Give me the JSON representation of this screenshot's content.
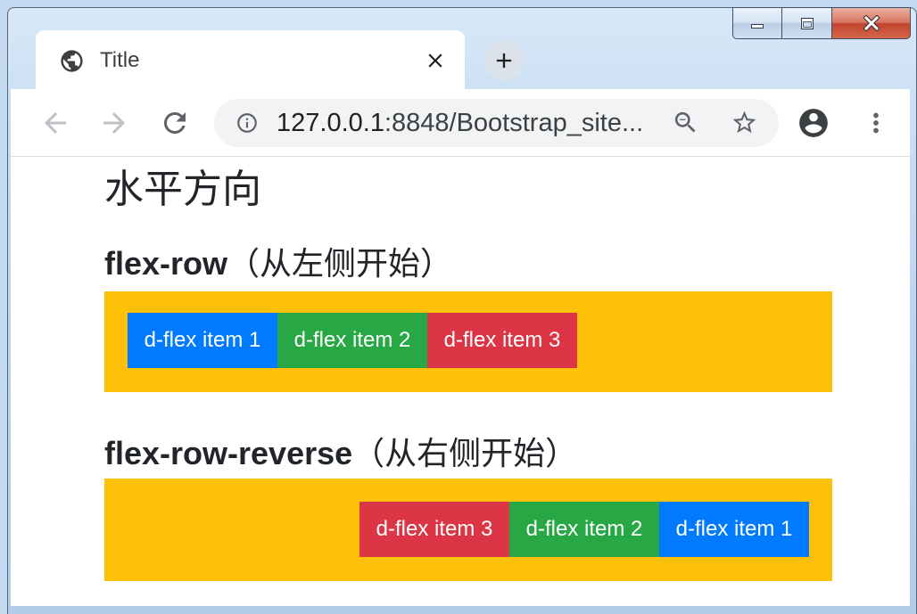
{
  "window_controls": {
    "minimize_icon": "minimize-icon",
    "maximize_icon": "maximize-icon",
    "close_icon": "close-icon"
  },
  "tab": {
    "favicon": "globe-icon",
    "title": "Title",
    "close_icon": "close-tab-icon"
  },
  "new_tab_icon": "plus-icon",
  "toolbar": {
    "back_icon": "arrow-back-icon",
    "forward_icon": "arrow-forward-icon",
    "reload_icon": "reload-icon",
    "site_info_icon": "info-icon",
    "url_host": "127.0.0.1",
    "url_rest": ":8848/Bootstrap_site...",
    "zoom_icon": "zoom-out-icon",
    "bookmark_icon": "star-icon",
    "profile_icon": "account-circle-icon",
    "menu_icon": "kebab-menu-icon"
  },
  "page": {
    "heading": "水平方向",
    "container_color": "#ffc107",
    "sections": [
      {
        "title_bold": "flex-row",
        "title_rest": "（从左侧开始）",
        "direction": "row",
        "items": [
          {
            "label": "d-flex item 1",
            "color": "#007bff"
          },
          {
            "label": "d-flex item 2",
            "color": "#28a745"
          },
          {
            "label": "d-flex item 3",
            "color": "#dc3545"
          }
        ]
      },
      {
        "title_bold": "flex-row-reverse",
        "title_rest": "（从右侧开始）",
        "direction": "row-reverse",
        "items": [
          {
            "label": "d-flex item 1",
            "color": "#007bff"
          },
          {
            "label": "d-flex item 2",
            "color": "#28a745"
          },
          {
            "label": "d-flex item 3",
            "color": "#dc3545"
          }
        ]
      }
    ]
  }
}
